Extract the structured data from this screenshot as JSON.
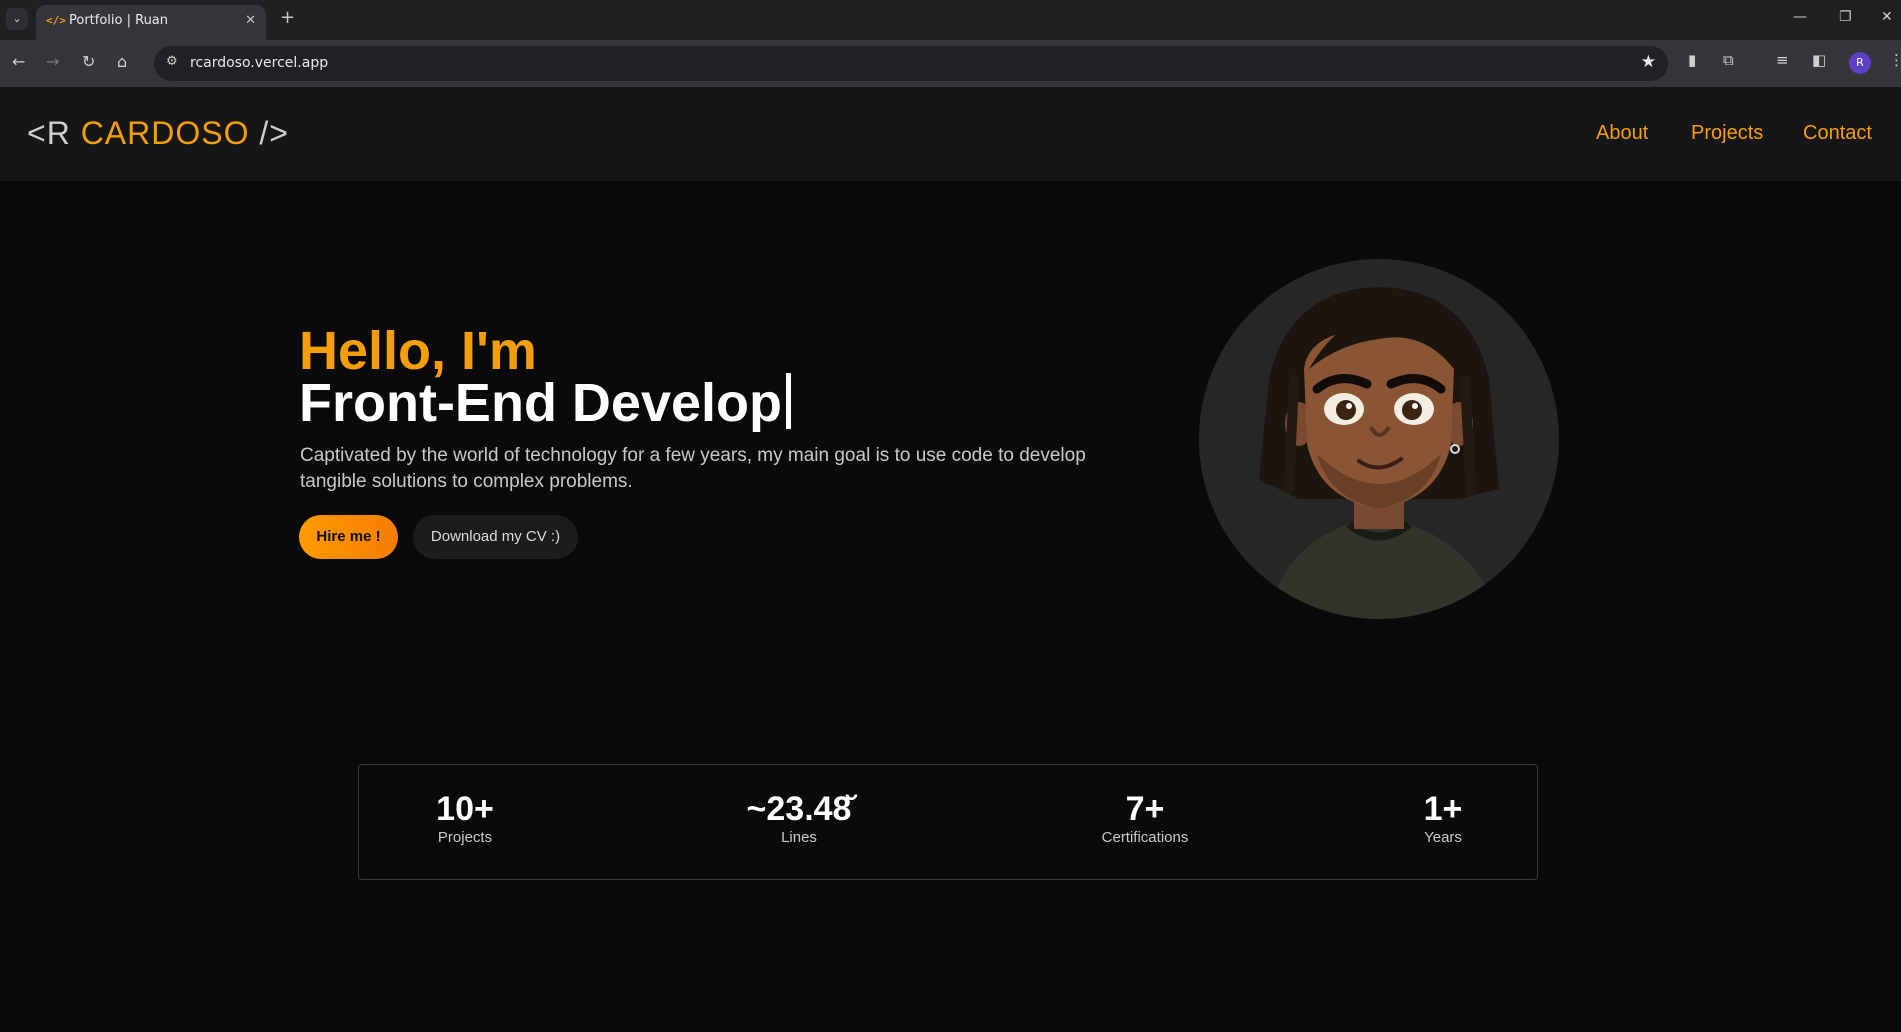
{
  "browser": {
    "tab_title": "Portfolio | Ruan",
    "tab_icon_glyph": "</>",
    "url": "rcardoso.vercel.app",
    "profile_initial": "R"
  },
  "header": {
    "logo_open": "<R ",
    "logo_name": "CARDOSO",
    "logo_close": " />",
    "nav": [
      "About",
      "Projects",
      "Contact"
    ],
    "accent_color": "#f59e0b"
  },
  "hero": {
    "greeting": "Hello, I'm",
    "role": "Front-End Develop",
    "description": "Captivated by the world of technology for a few years, my main goal is to use code to develop tangible solutions to complex problems.",
    "hire_label": "Hire me !",
    "cv_label": "Download my CV :)"
  },
  "stats": [
    {
      "value": "10+",
      "label": "Projects"
    },
    {
      "value": "~23.48̆",
      "label": "Lines"
    },
    {
      "value": "7+",
      "label": "Certifications"
    },
    {
      "value": "1+",
      "label": "Years"
    }
  ]
}
